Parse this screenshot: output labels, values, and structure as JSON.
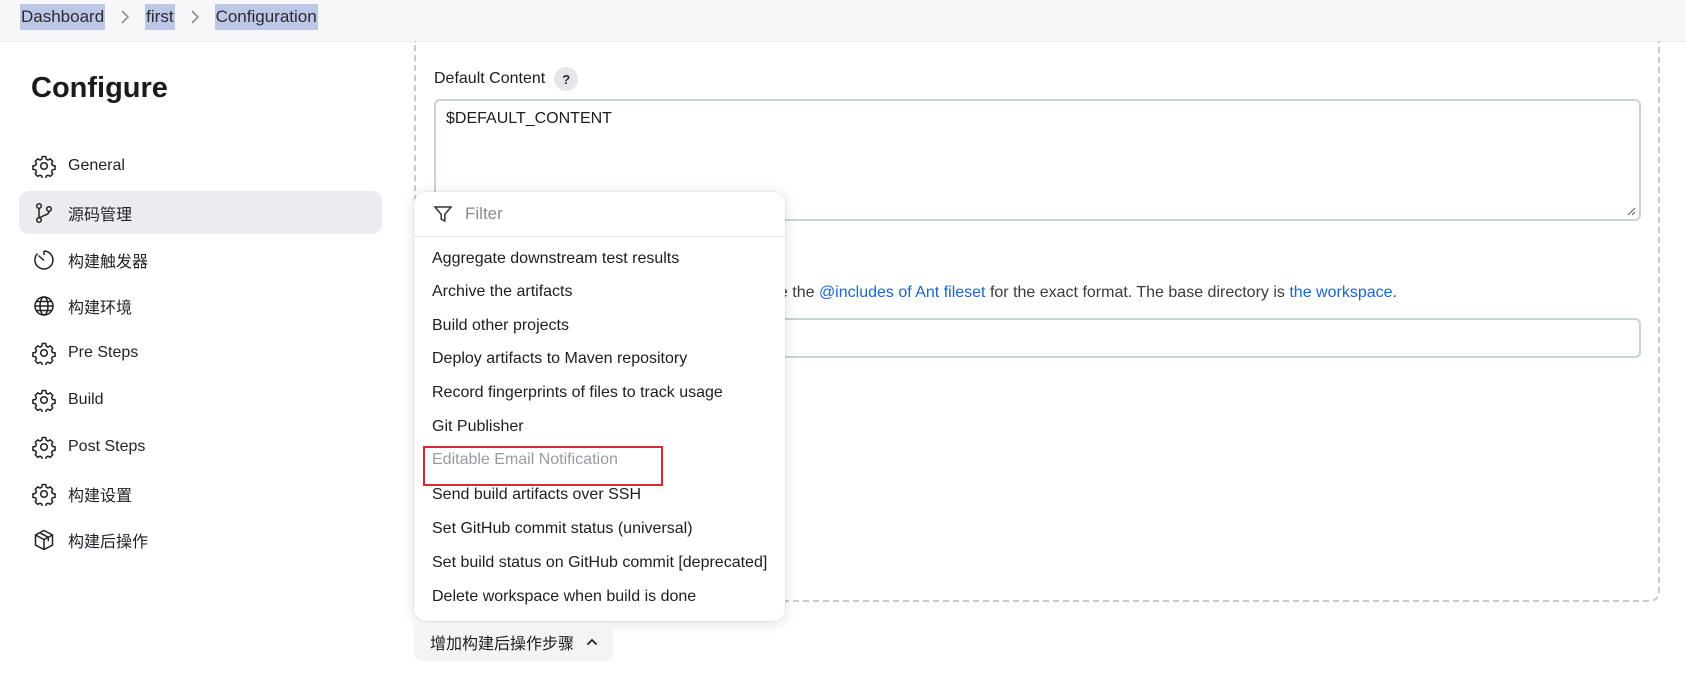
{
  "breadcrumb": {
    "items": [
      "Dashboard",
      "first",
      "Configuration"
    ],
    "separator": ">"
  },
  "sidebar": {
    "title": "Configure",
    "items": [
      {
        "label": "General",
        "icon": "gear-icon"
      },
      {
        "label": "源码管理",
        "icon": "git-branch-icon",
        "active": true
      },
      {
        "label": "构建触发器",
        "icon": "timer-icon"
      },
      {
        "label": "构建环境",
        "icon": "globe-icon"
      },
      {
        "label": "Pre Steps",
        "icon": "gear-icon"
      },
      {
        "label": "Build",
        "icon": "gear-icon"
      },
      {
        "label": "Post Steps",
        "icon": "gear-icon"
      },
      {
        "label": "构建设置",
        "icon": "gear-icon"
      },
      {
        "label": "构建后操作",
        "icon": "package-icon"
      }
    ]
  },
  "main": {
    "default_content_label": "Default Content",
    "help_label": "?",
    "default_content_value": "$DEFAULT_CONTENT",
    "desc": {
      "prefix": "ee the ",
      "link1": "@includes of Ant fileset",
      "middle": " for the exact format. The base directory is ",
      "link2": "the workspace",
      "suffix": "."
    }
  },
  "dropdown": {
    "filter_placeholder": "Filter",
    "items": [
      "Aggregate downstream test results",
      "Archive the artifacts",
      "Build other projects",
      "Deploy artifacts to Maven repository",
      "Record fingerprints of files to track usage",
      "Git Publisher",
      "Editable Email Notification",
      "Send build artifacts over SSH",
      "Set GitHub commit status (universal)",
      "Set build status on GitHub commit [deprecated]",
      "Delete workspace when build is done"
    ],
    "disabled_item": "Editable Email Notification"
  },
  "add_button": {
    "label": "增加构建后操作步骤"
  },
  "colors": {
    "link": "#1a66c9",
    "highlight_border": "#e0272f",
    "breadcrumb_selection": "#bcc8e5",
    "active_sidebar": "#ececf0"
  }
}
